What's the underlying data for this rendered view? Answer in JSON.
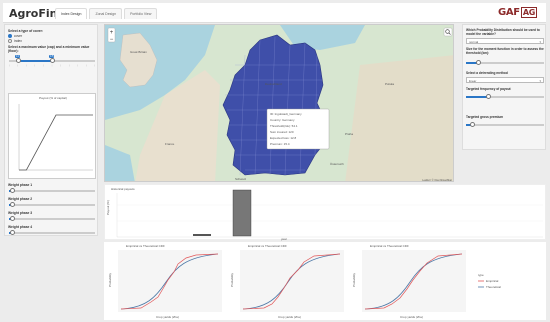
{
  "app": {
    "brand": "AgroFin",
    "brand_sub": "beta"
  },
  "tabs": [
    {
      "label": "Index Design",
      "active": true
    },
    {
      "label": "Zonal Design",
      "active": false
    },
    {
      "label": "Portfolio View",
      "active": false
    }
  ],
  "logo": {
    "main": "GAF",
    "box": "AG"
  },
  "left_panel": {
    "cover_type_label": "Select a type of cover:",
    "cover_options": [
      {
        "label": "cover",
        "selected": true
      },
      {
        "label": "index",
        "selected": false
      }
    ],
    "threshold_label": "Select a maximum value (cap) and a minimum value (floor):",
    "threshold_bubbles": [
      "0.1",
      "0.5"
    ],
    "payout_title": "Payout (% of capital)",
    "weight_labels": [
      "Weight phase 1",
      "Weight phase 2",
      "Weight phase 3",
      "Weight phase 4"
    ],
    "chart_data": {
      "type": "line",
      "title": "Payout (% of capital)",
      "x": [
        0,
        0.1,
        0.5,
        1
      ],
      "y": [
        0,
        0,
        100,
        100
      ],
      "xlim": [
        0,
        1
      ],
      "ylim": [
        0,
        120
      ]
    }
  },
  "right_panel": {
    "dist_label": "Which Probability Distribution should be used to model the variable?",
    "dist_value": "normal",
    "radius_label": "Size for the moment function in order to assess the threshold (km):",
    "method_label": "Select a detrending method",
    "method_value": "linear",
    "freq_label": "Targeted frequency of payout",
    "premium_label": "Targeted gross premium"
  },
  "map": {
    "attribution": "Leaflet | © OpenStreetMap",
    "city_labels": [
      "Great Britain",
      "Deutschland",
      "France",
      "Österreich",
      "Schweiz",
      "Polska",
      "Praha"
    ],
    "popup_lines": [
      "ID: Ingolstadt_Germany",
      "Country: Germany",
      "Threshold(risk): 54.1",
      "Sum insured: 120",
      "Expected loss: 12.8",
      "Premium: 15.4"
    ]
  },
  "histogram": {
    "title": "Historical payouts",
    "xlabel": "year",
    "ylabel": "Payout (%)"
  },
  "cdf_charts": [
    {
      "title": "Empirical vs Theoretical CDF",
      "xlabel": "Crop yields (t/ha)",
      "ylabel": "Probability"
    },
    {
      "title": "Empirical vs Theoretical CDF",
      "xlabel": "Crop yields (t/ha)",
      "ylabel": "Probability"
    },
    {
      "title": "Empirical vs Theoretical CDF",
      "xlabel": "Crop yields (t/ha)",
      "ylabel": "Probability"
    }
  ],
  "cdf_legend": {
    "title": "type",
    "items": [
      "Empirical",
      "Theoretical"
    ]
  },
  "colors": {
    "accent": "#2a76c6",
    "map_fill": "#3f4fa9",
    "empirical": "#e15759",
    "theoretical": "#4e79a7",
    "brand": "#8c2a2a"
  }
}
